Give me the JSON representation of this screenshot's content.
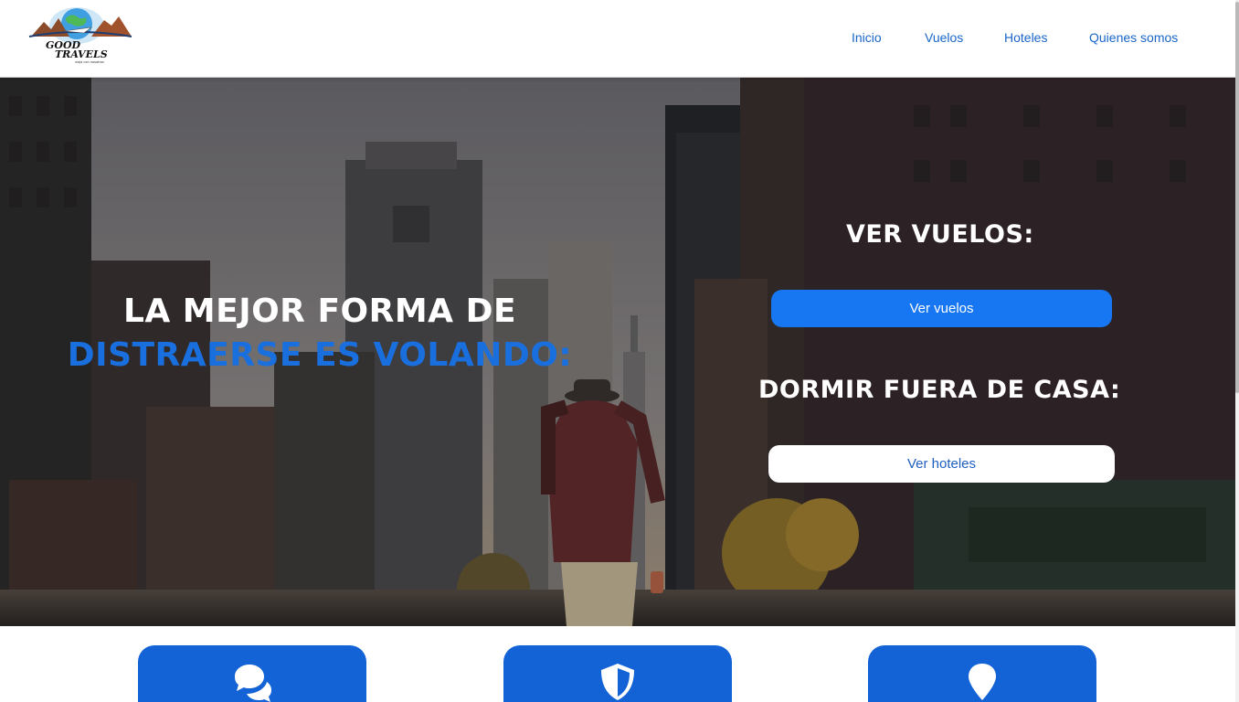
{
  "header": {
    "logo": {
      "name": "good-travels-logo",
      "text_line1": "GOOD",
      "text_line2": "TRAVELS",
      "tagline": "viaja con nosotros"
    },
    "nav": [
      {
        "label": "Inicio"
      },
      {
        "label": "Vuelos"
      },
      {
        "label": "Hoteles"
      },
      {
        "label": "Quienes somos"
      }
    ]
  },
  "hero": {
    "slogan_line1": "LA MEJOR FORMA DE",
    "slogan_line2": "DISTRAERSE ES VOLANDO:",
    "flights_title": "VER VUELOS:",
    "flights_button": "Ver vuelos",
    "hotels_title": "DORMIR FUERA DE CASA:",
    "hotels_button": "Ver hoteles",
    "background": "city-street-photo"
  },
  "features": [
    {
      "icon": "chat-bubbles-icon"
    },
    {
      "icon": "shield-icon"
    },
    {
      "icon": "location-pin-icon"
    }
  ],
  "colors": {
    "nav_link": "#1a66c9",
    "primary_button": "#1777f2",
    "slogan_accent": "#1a6fde",
    "card": "#1463d6",
    "white": "#ffffff"
  }
}
